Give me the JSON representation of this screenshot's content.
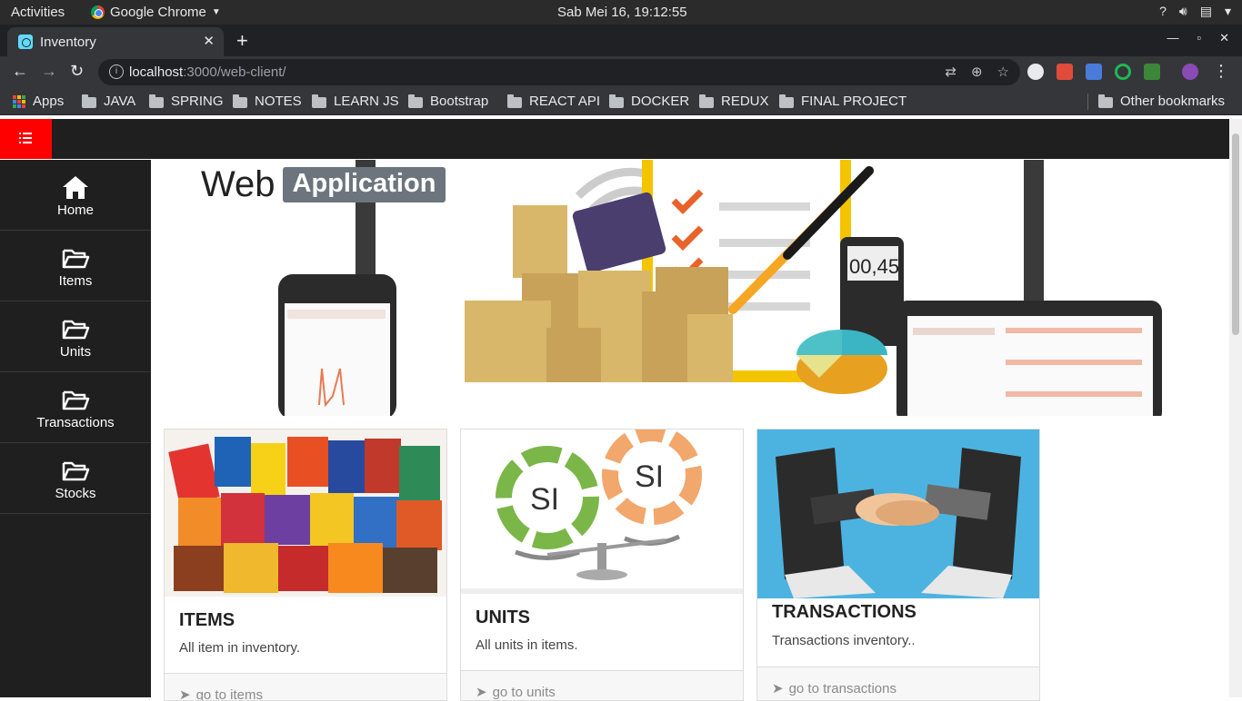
{
  "system": {
    "activities": "Activities",
    "app_name": "Google Chrome",
    "clock": "Sab Mei 16, 19:12:55",
    "tray_icons": [
      "question-icon",
      "volume-icon",
      "clipboard-icon",
      "power-menu-icon"
    ]
  },
  "browser": {
    "tab_title": "Inventory",
    "url_host": "localhost",
    "url_path": ":3000/web-client/",
    "bookmarks": [
      {
        "label": "Apps",
        "icon": "apps-grid-icon"
      },
      {
        "label": "JAVA",
        "icon": "folder-icon"
      },
      {
        "label": "SPRING",
        "icon": "folder-icon"
      },
      {
        "label": "NOTES",
        "icon": "folder-icon"
      },
      {
        "label": "LEARN JS",
        "icon": "folder-icon"
      },
      {
        "label": "Bootstrap",
        "icon": "folder-icon"
      },
      {
        "label": "REACT API",
        "icon": "folder-icon"
      },
      {
        "label": "DOCKER",
        "icon": "folder-icon"
      },
      {
        "label": "REDUX",
        "icon": "folder-icon"
      },
      {
        "label": "FINAL PROJECT",
        "icon": "folder-icon"
      }
    ],
    "other_bookmarks": "Other bookmarks"
  },
  "sidebar": {
    "items": [
      {
        "label": "Home",
        "icon": "home-icon"
      },
      {
        "label": "Items",
        "icon": "folder-open-icon"
      },
      {
        "label": "Units",
        "icon": "folder-open-icon"
      },
      {
        "label": "Transactions",
        "icon": "folder-open-icon"
      },
      {
        "label": "Stocks",
        "icon": "folder-open-icon"
      }
    ]
  },
  "hero": {
    "title": "Web",
    "badge": "Application"
  },
  "cards": [
    {
      "title": "ITEMS",
      "text": "All item in inventory.",
      "link": "go to items"
    },
    {
      "title": "UNITS",
      "text": "All units in items.",
      "link": "go to units"
    },
    {
      "title": "TRANSACTIONS",
      "text": "Transactions inventory..",
      "link": "go to transactions"
    }
  ],
  "colors": {
    "navbar": "#1f1f1f",
    "toggle": "#ff0000",
    "badge": "#6c757d"
  }
}
